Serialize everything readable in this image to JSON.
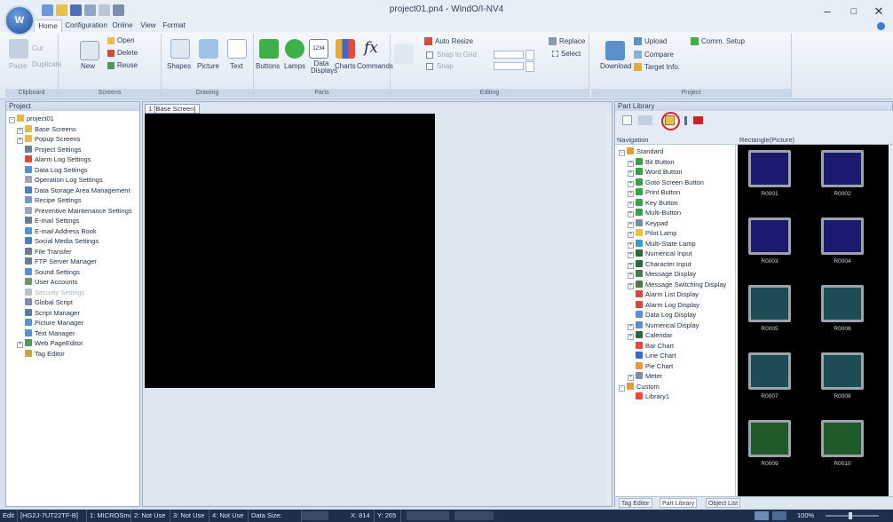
{
  "app": {
    "title": "project01.pn4 - WindO/I-NV4"
  },
  "ribbon_tabs": [
    "Home",
    "Configuration",
    "Online",
    "View",
    "Format"
  ],
  "ribbon": {
    "clipboard": {
      "group_label": "Clipboard",
      "paste": "Paste",
      "cut": "Cut",
      "duplicate": "Duplicate"
    },
    "screens": {
      "group_label": "Screens",
      "open": "Open",
      "delete": "Delete",
      "new": "New",
      "reuse": "Reuse"
    },
    "drawing": {
      "group_label": "Drawing",
      "shapes": "Shapes",
      "picture": "Picture",
      "text": "Text"
    },
    "parts": {
      "group_label": "Parts",
      "buttons": "Buttons",
      "lamps": "Lamps",
      "data_displays": "Data Displays",
      "charts": "Charts",
      "commands": "Commands",
      "data_icon_text": "1234"
    },
    "editing": {
      "group_label": "Editing",
      "auto_resize": "Auto Resize",
      "snap_grid": "Snap to Grid",
      "snap_label": "Snap",
      "replace": "Replace",
      "select": "Select"
    },
    "project": {
      "group_label": "Project",
      "download": "Download",
      "upload": "Upload",
      "comm_setup": "Comm. Setup",
      "compare": "Compare",
      "target_info": "Target Info."
    }
  },
  "project_pane": {
    "title": "Project",
    "items": [
      {
        "label": "project01",
        "level": 0,
        "exp": "-",
        "color": "#e8b84a"
      },
      {
        "label": "Base Screens",
        "level": 1,
        "exp": "+",
        "color": "#e8b84a"
      },
      {
        "label": "Popup Screens",
        "level": 1,
        "exp": "+",
        "color": "#e8b84a"
      },
      {
        "label": "Project Settings",
        "level": 1,
        "exp": "",
        "color": "#6a7f9c"
      },
      {
        "label": "Alarm Log Settings",
        "level": 1,
        "exp": "",
        "color": "#d24b3c"
      },
      {
        "label": "Data Log Settings",
        "level": 1,
        "exp": "",
        "color": "#5a8fd0"
      },
      {
        "label": "Operation Log Settings",
        "level": 1,
        "exp": "",
        "color": "#9aa7b8"
      },
      {
        "label": "Data Storage Area Management",
        "level": 1,
        "exp": "",
        "color": "#4a7fc0"
      },
      {
        "label": "Recipe Settings",
        "level": 1,
        "exp": "",
        "color": "#7a9ac0"
      },
      {
        "label": "Preventive Maintenance Settings",
        "level": 1,
        "exp": "",
        "color": "#9aa7b8"
      },
      {
        "label": "E-mail Settings",
        "level": 1,
        "exp": "",
        "color": "#6b7d96"
      },
      {
        "label": "E-mail Address Book",
        "level": 1,
        "exp": "",
        "color": "#5a8fd0"
      },
      {
        "label": "Social Media Settings",
        "level": 1,
        "exp": "",
        "color": "#4a7fc0"
      },
      {
        "label": "File Transfer",
        "level": 1,
        "exp": "",
        "color": "#6b7d96"
      },
      {
        "label": "FTP Server Manager",
        "level": 1,
        "exp": "",
        "color": "#6b7d96"
      },
      {
        "label": "Sound Settings",
        "level": 1,
        "exp": "",
        "color": "#5a8fd0"
      },
      {
        "label": "User Accounts",
        "level": 1,
        "exp": "",
        "color": "#6a9a6a"
      },
      {
        "label": "Security Settings",
        "level": 1,
        "exp": "",
        "color": "#b8c2cf",
        "disabled": true
      },
      {
        "label": "Global Script",
        "level": 1,
        "exp": "",
        "color": "#7a8ba3"
      },
      {
        "label": "Script Manager",
        "level": 1,
        "exp": "",
        "color": "#5a7aa0"
      },
      {
        "label": "Picture Manager",
        "level": 1,
        "exp": "",
        "color": "#5a8fd0"
      },
      {
        "label": "Text Manager",
        "level": 1,
        "exp": "",
        "color": "#5a8fd0"
      },
      {
        "label": "Web PageEditor",
        "level": 1,
        "exp": "+",
        "color": "#4a9a5a"
      },
      {
        "label": "Tag Editor",
        "level": 1,
        "exp": "",
        "color": "#c9a24a"
      }
    ]
  },
  "editor": {
    "tab_label": "1 [Base Screen]"
  },
  "part_library": {
    "title": "Part Library",
    "nav_label": "Navigation",
    "gallery_label": "Rectangle(Picture)",
    "nav_items": [
      {
        "label": "Standard",
        "level": 0,
        "exp": "-",
        "color": "#e89a3a"
      },
      {
        "label": "Bit Button",
        "level": 1,
        "exp": "+",
        "color": "#3aa04a"
      },
      {
        "label": "Word Button",
        "level": 1,
        "exp": "+",
        "color": "#3aa04a"
      },
      {
        "label": "Goto Screen Button",
        "level": 1,
        "exp": "+",
        "color": "#3aa04a"
      },
      {
        "label": "Print Button",
        "level": 1,
        "exp": "+",
        "color": "#3aa04a"
      },
      {
        "label": "Key Button",
        "level": 1,
        "exp": "+",
        "color": "#3aa04a"
      },
      {
        "label": "Multi-Button",
        "level": 1,
        "exp": "+",
        "color": "#3aa04a"
      },
      {
        "label": "Keypad",
        "level": 1,
        "exp": "+",
        "color": "#7a8ba3"
      },
      {
        "label": "Pilot Lamp",
        "level": 1,
        "exp": "+",
        "color": "#e8c43a"
      },
      {
        "label": "Multi-State Lamp",
        "level": 1,
        "exp": "+",
        "color": "#3aa0c0"
      },
      {
        "label": "Numerical Input",
        "level": 1,
        "exp": "+",
        "color": "#2a6a3a"
      },
      {
        "label": "Character Input",
        "level": 1,
        "exp": "+",
        "color": "#2a6a3a"
      },
      {
        "label": "Message Display",
        "level": 1,
        "exp": "+",
        "color": "#4a7a4a"
      },
      {
        "label": "Message Switching Display",
        "level": 1,
        "exp": "+",
        "color": "#4a7a4a"
      },
      {
        "label": "Alarm List Display",
        "level": 1,
        "exp": "",
        "color": "#d24b3c"
      },
      {
        "label": "Alarm Log Display",
        "level": 1,
        "exp": "",
        "color": "#d24b3c"
      },
      {
        "label": "Data Log Display",
        "level": 1,
        "exp": "",
        "color": "#5a8fd0"
      },
      {
        "label": "Numerical Display",
        "level": 1,
        "exp": "+",
        "color": "#5a8fd0"
      },
      {
        "label": "Calendar",
        "level": 1,
        "exp": "+",
        "color": "#2a6a3a"
      },
      {
        "label": "Bar Chart",
        "level": 1,
        "exp": "",
        "color": "#e84a3a"
      },
      {
        "label": "Line Chart",
        "level": 1,
        "exp": "",
        "color": "#3a6ad0"
      },
      {
        "label": "Pie Chart",
        "level": 1,
        "exp": "",
        "color": "#e89a3a"
      },
      {
        "label": "Meter",
        "level": 1,
        "exp": "+",
        "color": "#7a8ba3"
      },
      {
        "label": "Custom",
        "level": 0,
        "exp": "-",
        "color": "#e89a3a"
      },
      {
        "label": "Library1",
        "level": 1,
        "exp": "",
        "color": "#e84a3a"
      }
    ],
    "tiles": [
      {
        "label": "R0001",
        "fill": "#1c1a6e"
      },
      {
        "label": "R0002",
        "fill": "#1c1a6e"
      },
      {
        "label": "R0003",
        "fill": "#1c1a6e"
      },
      {
        "label": "R0004",
        "fill": "#1c1a6e"
      },
      {
        "label": "R0005",
        "fill": "#1d4c55"
      },
      {
        "label": "R0006",
        "fill": "#1d4c55"
      },
      {
        "label": "R0007",
        "fill": "#1d4c55"
      },
      {
        "label": "R0008",
        "fill": "#1d4c55"
      },
      {
        "label": "R0009",
        "fill": "#1e5a2a"
      },
      {
        "label": "R0010",
        "fill": "#1e5a2a"
      }
    ],
    "bottom_tabs": [
      "Tag Editor",
      "Part Library",
      "Object List"
    ]
  },
  "status_bar": {
    "mode": "Edit",
    "station1": "[HG2J-7UT22TF-B]",
    "port1": "1: MICROSmar",
    "port2": "2: Not Use",
    "port3": "3: Not Use",
    "port4": "4: Not Use",
    "data_size": "Data Size:",
    "x": "X: 814",
    "y": "Y: 265",
    "zoom": "100%"
  },
  "colors": {
    "highlight_ring": "#e0202a",
    "canvas": "#000000",
    "ribbon_bg": "#e8eef5"
  }
}
